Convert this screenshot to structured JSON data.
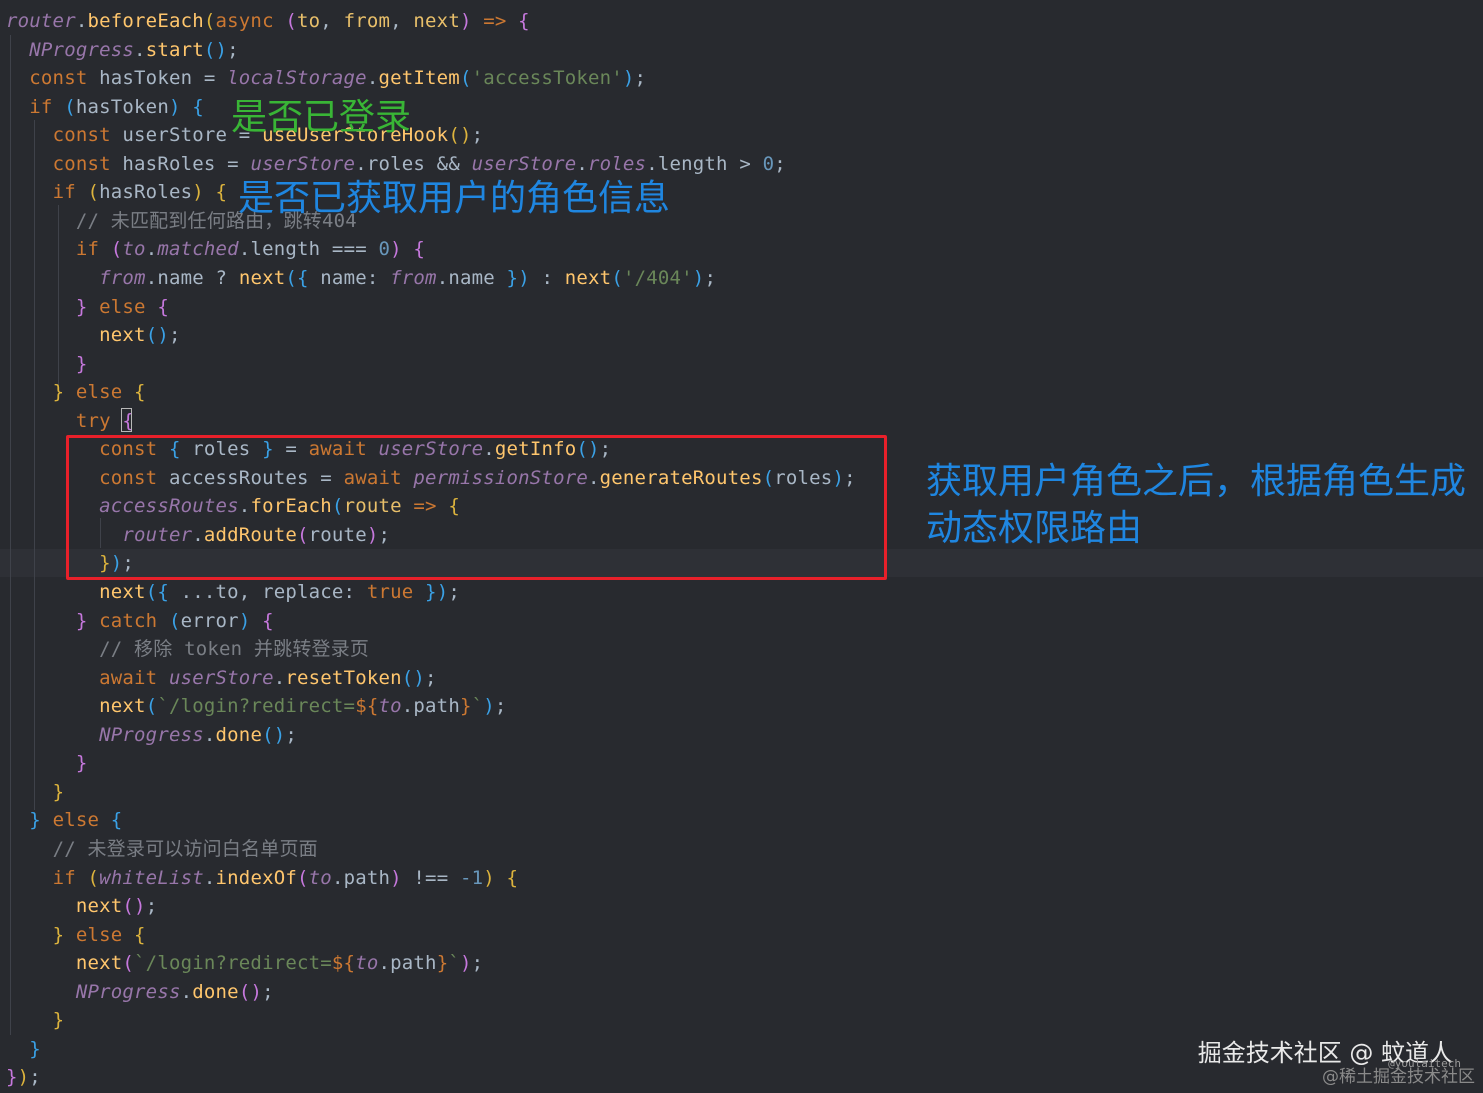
{
  "code": {
    "lines": [
      [
        [
          "t-it",
          "router"
        ],
        [
          "t-pl",
          "."
        ],
        [
          "t-fn",
          "beforeEach"
        ],
        [
          "t-br1",
          "("
        ],
        [
          "t-kw",
          "async"
        ],
        [
          "t-pl",
          " "
        ],
        [
          "t-br2",
          "("
        ],
        [
          "t-pa",
          "to"
        ],
        [
          "t-pl",
          ", "
        ],
        [
          "t-pa",
          "from"
        ],
        [
          "t-pl",
          ", "
        ],
        [
          "t-pa",
          "next"
        ],
        [
          "t-br2",
          ")"
        ],
        [
          "t-pl",
          " "
        ],
        [
          "t-kw",
          "=>"
        ],
        [
          "t-pl",
          " "
        ],
        [
          "t-br2",
          "{"
        ]
      ],
      [
        [
          "t-pl",
          "  "
        ],
        [
          "t-it",
          "NProgress"
        ],
        [
          "t-pl",
          "."
        ],
        [
          "t-fn",
          "start"
        ],
        [
          "t-br3",
          "()"
        ],
        [
          "t-pl",
          ";"
        ]
      ],
      [
        [
          "t-pl",
          "  "
        ],
        [
          "t-kw",
          "const"
        ],
        [
          "t-pl",
          " hasToken = "
        ],
        [
          "t-it",
          "localStorage"
        ],
        [
          "t-pl",
          "."
        ],
        [
          "t-fn",
          "getItem"
        ],
        [
          "t-br3",
          "("
        ],
        [
          "t-str",
          "'accessToken'"
        ],
        [
          "t-br3",
          ")"
        ],
        [
          "t-pl",
          ";"
        ]
      ],
      [
        [
          "t-pl",
          "  "
        ],
        [
          "t-kw",
          "if"
        ],
        [
          "t-pl",
          " "
        ],
        [
          "t-br3",
          "("
        ],
        [
          "t-pl",
          "hasToken"
        ],
        [
          "t-br3",
          ")"
        ],
        [
          "t-pl",
          " "
        ],
        [
          "t-br3",
          "{"
        ]
      ],
      [
        [
          "t-pl",
          "    "
        ],
        [
          "t-kw",
          "const"
        ],
        [
          "t-pl",
          " userStore = "
        ],
        [
          "t-fn",
          "useUserStoreHook"
        ],
        [
          "t-br1",
          "()"
        ],
        [
          "t-pl",
          ";"
        ]
      ],
      [
        [
          "t-pl",
          "    "
        ],
        [
          "t-kw",
          "const"
        ],
        [
          "t-pl",
          " hasRoles = "
        ],
        [
          "t-it",
          "userStore"
        ],
        [
          "t-pl",
          ".roles && "
        ],
        [
          "t-it",
          "userStore"
        ],
        [
          "t-pl",
          "."
        ],
        [
          "t-it",
          "roles"
        ],
        [
          "t-pl",
          ".length > "
        ],
        [
          "t-num",
          "0"
        ],
        [
          "t-pl",
          ";"
        ]
      ],
      [
        [
          "t-pl",
          "    "
        ],
        [
          "t-kw",
          "if"
        ],
        [
          "t-pl",
          " "
        ],
        [
          "t-br1",
          "("
        ],
        [
          "t-pl",
          "hasRoles"
        ],
        [
          "t-br1",
          ")"
        ],
        [
          "t-pl",
          " "
        ],
        [
          "t-br1",
          "{"
        ]
      ],
      [
        [
          "t-pl",
          "      "
        ],
        [
          "t-cm",
          "// 未匹配到任何路由，跳转404"
        ]
      ],
      [
        [
          "t-pl",
          "      "
        ],
        [
          "t-kw",
          "if"
        ],
        [
          "t-pl",
          " "
        ],
        [
          "t-br2",
          "("
        ],
        [
          "t-it",
          "to"
        ],
        [
          "t-pl",
          "."
        ],
        [
          "t-it",
          "matched"
        ],
        [
          "t-pl",
          ".length === "
        ],
        [
          "t-num",
          "0"
        ],
        [
          "t-br2",
          ")"
        ],
        [
          "t-pl",
          " "
        ],
        [
          "t-br2",
          "{"
        ]
      ],
      [
        [
          "t-pl",
          "        "
        ],
        [
          "t-it",
          "from"
        ],
        [
          "t-pl",
          ".name ? "
        ],
        [
          "t-fn",
          "next"
        ],
        [
          "t-br3",
          "("
        ],
        [
          "t-br3",
          "{"
        ],
        [
          "t-pl",
          " name: "
        ],
        [
          "t-it",
          "from"
        ],
        [
          "t-pl",
          ".name "
        ],
        [
          "t-br3",
          "}"
        ],
        [
          "t-br3",
          ")"
        ],
        [
          "t-pl",
          " : "
        ],
        [
          "t-fn",
          "next"
        ],
        [
          "t-br3",
          "("
        ],
        [
          "t-str",
          "'/404'"
        ],
        [
          "t-br3",
          ")"
        ],
        [
          "t-pl",
          ";"
        ]
      ],
      [
        [
          "t-pl",
          "      "
        ],
        [
          "t-br2",
          "}"
        ],
        [
          "t-pl",
          " "
        ],
        [
          "t-kw",
          "else"
        ],
        [
          "t-pl",
          " "
        ],
        [
          "t-br2",
          "{"
        ]
      ],
      [
        [
          "t-pl",
          "        "
        ],
        [
          "t-fn",
          "next"
        ],
        [
          "t-br3",
          "()"
        ],
        [
          "t-pl",
          ";"
        ]
      ],
      [
        [
          "t-pl",
          "      "
        ],
        [
          "t-br2",
          "}"
        ]
      ],
      [
        [
          "t-pl",
          "    "
        ],
        [
          "t-br1",
          "}"
        ],
        [
          "t-pl",
          " "
        ],
        [
          "t-kw",
          "else"
        ],
        [
          "t-pl",
          " "
        ],
        [
          "t-br1",
          "{"
        ]
      ],
      [
        [
          "t-pl",
          "      "
        ],
        [
          "t-kw",
          "try"
        ],
        [
          "t-pl",
          " "
        ],
        [
          "t-br2",
          "{"
        ]
      ],
      [
        [
          "t-pl",
          "        "
        ],
        [
          "t-kw",
          "const"
        ],
        [
          "t-pl",
          " "
        ],
        [
          "t-br3",
          "{"
        ],
        [
          "t-pl",
          " roles "
        ],
        [
          "t-br3",
          "}"
        ],
        [
          "t-pl",
          " = "
        ],
        [
          "t-kw",
          "await"
        ],
        [
          "t-pl",
          " "
        ],
        [
          "t-it",
          "userStore"
        ],
        [
          "t-pl",
          "."
        ],
        [
          "t-fn",
          "getInfo"
        ],
        [
          "t-br3",
          "()"
        ],
        [
          "t-pl",
          ";"
        ]
      ],
      [
        [
          "t-pl",
          "        "
        ],
        [
          "t-kw",
          "const"
        ],
        [
          "t-pl",
          " accessRoutes = "
        ],
        [
          "t-kw",
          "await"
        ],
        [
          "t-pl",
          " "
        ],
        [
          "t-it",
          "permissionStore"
        ],
        [
          "t-pl",
          "."
        ],
        [
          "t-fn",
          "generateRoutes"
        ],
        [
          "t-br3",
          "("
        ],
        [
          "t-pl",
          "roles"
        ],
        [
          "t-br3",
          ")"
        ],
        [
          "t-pl",
          ";"
        ]
      ],
      [
        [
          "t-pl",
          "        "
        ],
        [
          "t-it",
          "accessRoutes"
        ],
        [
          "t-pl",
          "."
        ],
        [
          "t-fn",
          "forEach"
        ],
        [
          "t-br3",
          "("
        ],
        [
          "t-pa",
          "route"
        ],
        [
          "t-pl",
          " "
        ],
        [
          "t-kw",
          "=>"
        ],
        [
          "t-pl",
          " "
        ],
        [
          "t-br1",
          "{"
        ]
      ],
      [
        [
          "t-pl",
          "          "
        ],
        [
          "t-it",
          "router"
        ],
        [
          "t-pl",
          "."
        ],
        [
          "t-fn",
          "addRoute"
        ],
        [
          "t-br2",
          "("
        ],
        [
          "t-pl",
          "route"
        ],
        [
          "t-br2",
          ")"
        ],
        [
          "t-pl",
          ";"
        ]
      ],
      [
        [
          "t-pl",
          "        "
        ],
        [
          "t-br1",
          "}"
        ],
        [
          "t-br3",
          ")"
        ],
        [
          "t-pl",
          ";"
        ]
      ],
      [
        [
          "t-pl",
          "        "
        ],
        [
          "t-fn",
          "next"
        ],
        [
          "t-br3",
          "("
        ],
        [
          "t-br3",
          "{"
        ],
        [
          "t-pl",
          " ...to, replace: "
        ],
        [
          "t-kw",
          "true"
        ],
        [
          "t-pl",
          " "
        ],
        [
          "t-br3",
          "}"
        ],
        [
          "t-br3",
          ")"
        ],
        [
          "t-pl",
          ";"
        ]
      ],
      [
        [
          "t-pl",
          "      "
        ],
        [
          "t-br2",
          "}"
        ],
        [
          "t-pl",
          " "
        ],
        [
          "t-kw",
          "catch"
        ],
        [
          "t-pl",
          " "
        ],
        [
          "t-br3",
          "("
        ],
        [
          "t-pl",
          "error"
        ],
        [
          "t-br3",
          ")"
        ],
        [
          "t-pl",
          " "
        ],
        [
          "t-br2",
          "{"
        ]
      ],
      [
        [
          "t-pl",
          "        "
        ],
        [
          "t-cm",
          "// 移除 token 并跳转登录页"
        ]
      ],
      [
        [
          "t-pl",
          "        "
        ],
        [
          "t-kw",
          "await"
        ],
        [
          "t-pl",
          " "
        ],
        [
          "t-it",
          "userStore"
        ],
        [
          "t-pl",
          "."
        ],
        [
          "t-fn",
          "resetToken"
        ],
        [
          "t-br3",
          "()"
        ],
        [
          "t-pl",
          ";"
        ]
      ],
      [
        [
          "t-pl",
          "        "
        ],
        [
          "t-fn",
          "next"
        ],
        [
          "t-br3",
          "("
        ],
        [
          "t-str",
          "`/login?redirect="
        ],
        [
          "t-kw",
          "${"
        ],
        [
          "t-it",
          "to"
        ],
        [
          "t-pl",
          ".path"
        ],
        [
          "t-kw",
          "}"
        ],
        [
          "t-str",
          "`"
        ],
        [
          "t-br3",
          ")"
        ],
        [
          "t-pl",
          ";"
        ]
      ],
      [
        [
          "t-pl",
          "        "
        ],
        [
          "t-it",
          "NProgress"
        ],
        [
          "t-pl",
          "."
        ],
        [
          "t-fn",
          "done"
        ],
        [
          "t-br3",
          "()"
        ],
        [
          "t-pl",
          ";"
        ]
      ],
      [
        [
          "t-pl",
          "      "
        ],
        [
          "t-br2",
          "}"
        ]
      ],
      [
        [
          "t-pl",
          "    "
        ],
        [
          "t-br1",
          "}"
        ]
      ],
      [
        [
          "t-pl",
          "  "
        ],
        [
          "t-br3",
          "}"
        ],
        [
          "t-pl",
          " "
        ],
        [
          "t-kw",
          "else"
        ],
        [
          "t-pl",
          " "
        ],
        [
          "t-br3",
          "{"
        ]
      ],
      [
        [
          "t-pl",
          "    "
        ],
        [
          "t-cm",
          "// 未登录可以访问白名单页面"
        ]
      ],
      [
        [
          "t-pl",
          "    "
        ],
        [
          "t-kw",
          "if"
        ],
        [
          "t-pl",
          " "
        ],
        [
          "t-br1",
          "("
        ],
        [
          "t-it",
          "whiteList"
        ],
        [
          "t-pl",
          "."
        ],
        [
          "t-fn",
          "indexOf"
        ],
        [
          "t-br2",
          "("
        ],
        [
          "t-it",
          "to"
        ],
        [
          "t-pl",
          ".path"
        ],
        [
          "t-br2",
          ")"
        ],
        [
          "t-pl",
          " !== "
        ],
        [
          "t-num",
          "-1"
        ],
        [
          "t-br1",
          ")"
        ],
        [
          "t-pl",
          " "
        ],
        [
          "t-br1",
          "{"
        ]
      ],
      [
        [
          "t-pl",
          "      "
        ],
        [
          "t-fn",
          "next"
        ],
        [
          "t-br2",
          "()"
        ],
        [
          "t-pl",
          ";"
        ]
      ],
      [
        [
          "t-pl",
          "    "
        ],
        [
          "t-br1",
          "}"
        ],
        [
          "t-pl",
          " "
        ],
        [
          "t-kw",
          "else"
        ],
        [
          "t-pl",
          " "
        ],
        [
          "t-br1",
          "{"
        ]
      ],
      [
        [
          "t-pl",
          "      "
        ],
        [
          "t-fn",
          "next"
        ],
        [
          "t-br2",
          "("
        ],
        [
          "t-str",
          "`/login?redirect="
        ],
        [
          "t-kw",
          "${"
        ],
        [
          "t-it",
          "to"
        ],
        [
          "t-pl",
          ".path"
        ],
        [
          "t-kw",
          "}"
        ],
        [
          "t-str",
          "`"
        ],
        [
          "t-br2",
          ")"
        ],
        [
          "t-pl",
          ";"
        ]
      ],
      [
        [
          "t-pl",
          "      "
        ],
        [
          "t-it",
          "NProgress"
        ],
        [
          "t-pl",
          "."
        ],
        [
          "t-fn",
          "done"
        ],
        [
          "t-br2",
          "()"
        ],
        [
          "t-pl",
          ";"
        ]
      ],
      [
        [
          "t-pl",
          "    "
        ],
        [
          "t-br1",
          "}"
        ]
      ],
      [
        [
          "t-pl",
          "  "
        ],
        [
          "t-br3",
          "}"
        ]
      ],
      [
        [
          "t-br2",
          "}"
        ],
        [
          "t-br1",
          ")"
        ],
        [
          "t-pl",
          ";"
        ]
      ]
    ]
  },
  "annotations": {
    "login_check": "是否已登录",
    "roles_check": "是否已获取用户的角色信息",
    "dynamic_routes_line1": "获取用户角色之后，根据角色生成",
    "dynamic_routes_line2": "动态权限路由"
  },
  "watermark": {
    "main": "掘金技术社区 @ 蚊道人",
    "sub": "@稀土掘金技术社区",
    "small": "@youlaitech"
  },
  "colors": {
    "background": "#282a2f",
    "annotation_green": "#39b536",
    "annotation_blue": "#1f86e0",
    "highlight_box": "#e8202a"
  }
}
